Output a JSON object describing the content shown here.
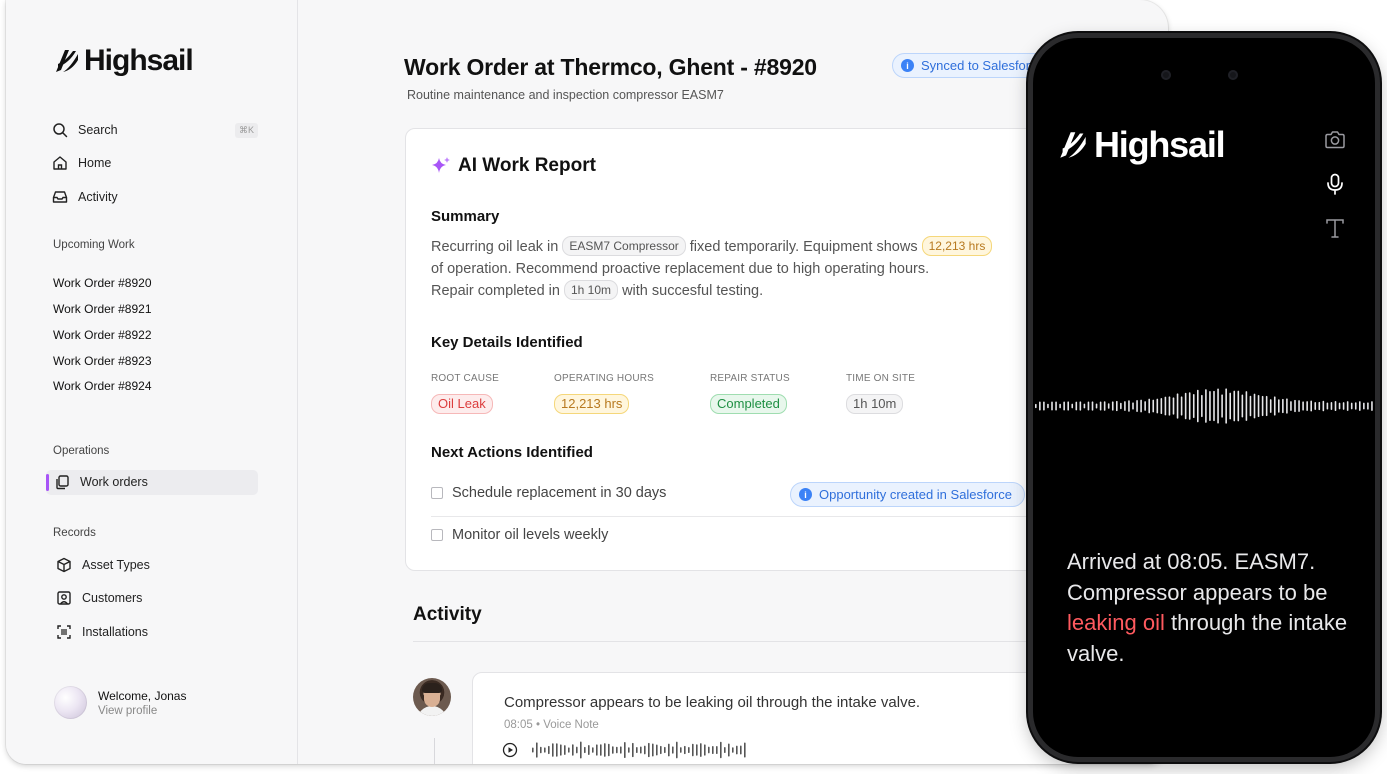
{
  "brand": {
    "name": "Highsail"
  },
  "sidebar": {
    "nav": [
      {
        "label": "Search",
        "shortcut": "⌘K",
        "icon": "search-icon"
      },
      {
        "label": "Home",
        "icon": "home-icon"
      },
      {
        "label": "Activity",
        "icon": "inbox-icon"
      }
    ],
    "upcoming": {
      "label": "Upcoming Work",
      "items": [
        "Work Order #8920",
        "Work Order #8921",
        "Work Order #8922",
        "Work Order #8923",
        "Work Order #8924"
      ]
    },
    "operations": {
      "label": "Operations",
      "items": [
        {
          "label": "Work orders",
          "icon": "copy-icon",
          "active": true
        }
      ]
    },
    "records": {
      "label": "Records",
      "items": [
        {
          "label": "Asset Types",
          "icon": "cube-icon"
        },
        {
          "label": "Customers",
          "icon": "contact-icon"
        },
        {
          "label": "Installations",
          "icon": "scan-icon"
        }
      ]
    },
    "profile": {
      "name": "Welcome, Jonas",
      "link": "View profile"
    }
  },
  "header": {
    "title": "Work Order at Thermco, Ghent - #8920",
    "subtitle": "Routine maintenance and inspection compressor EASM7",
    "sync_badge": "Synced to Salesforce"
  },
  "report": {
    "title": "AI Work Report",
    "summary": {
      "heading": "Summary",
      "line1_pre": "Recurring oil leak in",
      "line1_chip": "EASM7 Compressor",
      "line1_mid": "fixed temporarily. Equipment shows",
      "line1_chip2": "12,213 hrs",
      "line2": "of operation. Recommend proactive replacement due to high operating hours.",
      "line3_pre": "Repair completed in",
      "line3_chip": "1h 10m",
      "line3_post": "with succesful testing."
    },
    "key_details": {
      "heading": "Key Details Identified",
      "items": [
        {
          "label": "ROOT CAUSE",
          "value": "Oil Leak",
          "tone": "red"
        },
        {
          "label": "OPERATING HOURS",
          "value": "12,213 hrs",
          "tone": "amber"
        },
        {
          "label": "REPAIR STATUS",
          "value": "Completed",
          "tone": "green"
        },
        {
          "label": "TIME ON SITE",
          "value": "1h 10m",
          "tone": "gray"
        }
      ]
    },
    "next_actions": {
      "heading": "Next Actions Identified",
      "items": [
        {
          "label": "Schedule replacement in 30 days",
          "checked": false,
          "badge": "Opportunity created in Salesforce"
        },
        {
          "label": "Monitor oil levels weekly",
          "checked": false
        }
      ]
    }
  },
  "activity": {
    "title": "Activity",
    "entries": [
      {
        "text": "Compressor appears to be leaking oil through the intake valve.",
        "time": "08:05",
        "type": "Voice Note"
      }
    ]
  },
  "phone": {
    "brand": "Highsail",
    "tools": [
      "camera-icon",
      "microphone-icon",
      "text-icon"
    ],
    "transcript": {
      "part1": "Arrived at 08:05. EASM7. Compressor appears to be ",
      "highlight": "leaking oil",
      "part2": " through the intake valve."
    }
  },
  "colors": {
    "accent": "#a855f7",
    "salesforce_blue": "#2f6fdb",
    "highlight_red": "#ff5a5f",
    "amber": "#b7791f",
    "green": "#1f8f43"
  }
}
